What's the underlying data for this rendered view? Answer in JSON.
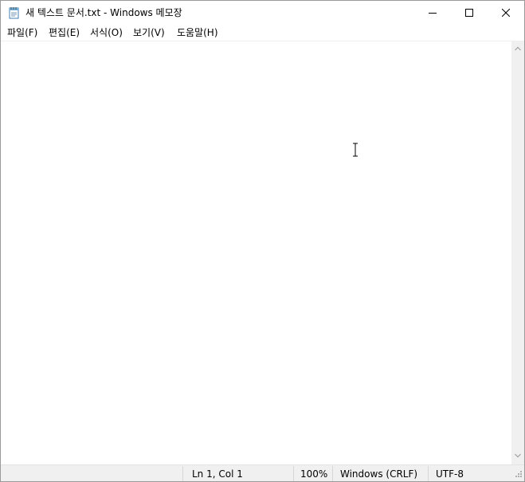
{
  "window": {
    "title": "새 텍스트 문서.txt - Windows 메모장"
  },
  "icons": {
    "app": "notepad-icon",
    "minimize": "minimize-icon",
    "maximize": "maximize-icon",
    "close": "close-icon",
    "cursor": "text-cursor-icon",
    "scroll_up": "chevron-up-icon",
    "scroll_down": "chevron-down-icon",
    "grip": "resize-grip-icon"
  },
  "menu": {
    "items": [
      {
        "label": "파일(F)"
      },
      {
        "label": "편집(E)"
      },
      {
        "label": "서식(O)"
      },
      {
        "label": "보기(V)"
      },
      {
        "label": "도움말(H)"
      }
    ]
  },
  "editor": {
    "content": ""
  },
  "statusbar": {
    "position": "Ln 1, Col 1",
    "zoom": "100%",
    "line_ending": "Windows (CRLF)",
    "encoding": "UTF-8"
  },
  "colors": {
    "statusbar_bg": "#f0f0f0",
    "scrollbar_bg": "#f0f0f0",
    "window_bg": "#ffffff"
  }
}
